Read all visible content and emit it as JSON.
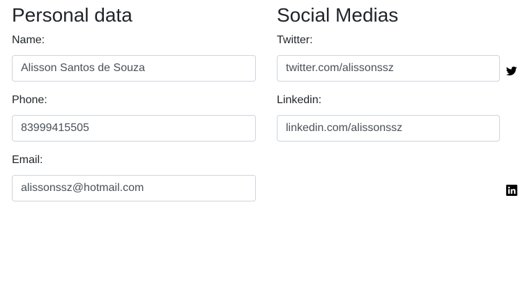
{
  "personal": {
    "title": "Personal data",
    "name_label": "Name:",
    "name_value": "Alisson Santos de Souza",
    "phone_label": "Phone:",
    "phone_value": "83999415505",
    "email_label": "Email:",
    "email_value": "alissonssz@hotmail.com"
  },
  "social": {
    "title": "Social Medias",
    "twitter_label": "Twitter:",
    "twitter_value": "twitter.com/alissonssz",
    "twitter_icon": "twitter-icon",
    "linkedin_label": "Linkedin:",
    "linkedin_value": "linkedin.com/alissonssz",
    "linkedin_icon": "linkedin-icon"
  }
}
